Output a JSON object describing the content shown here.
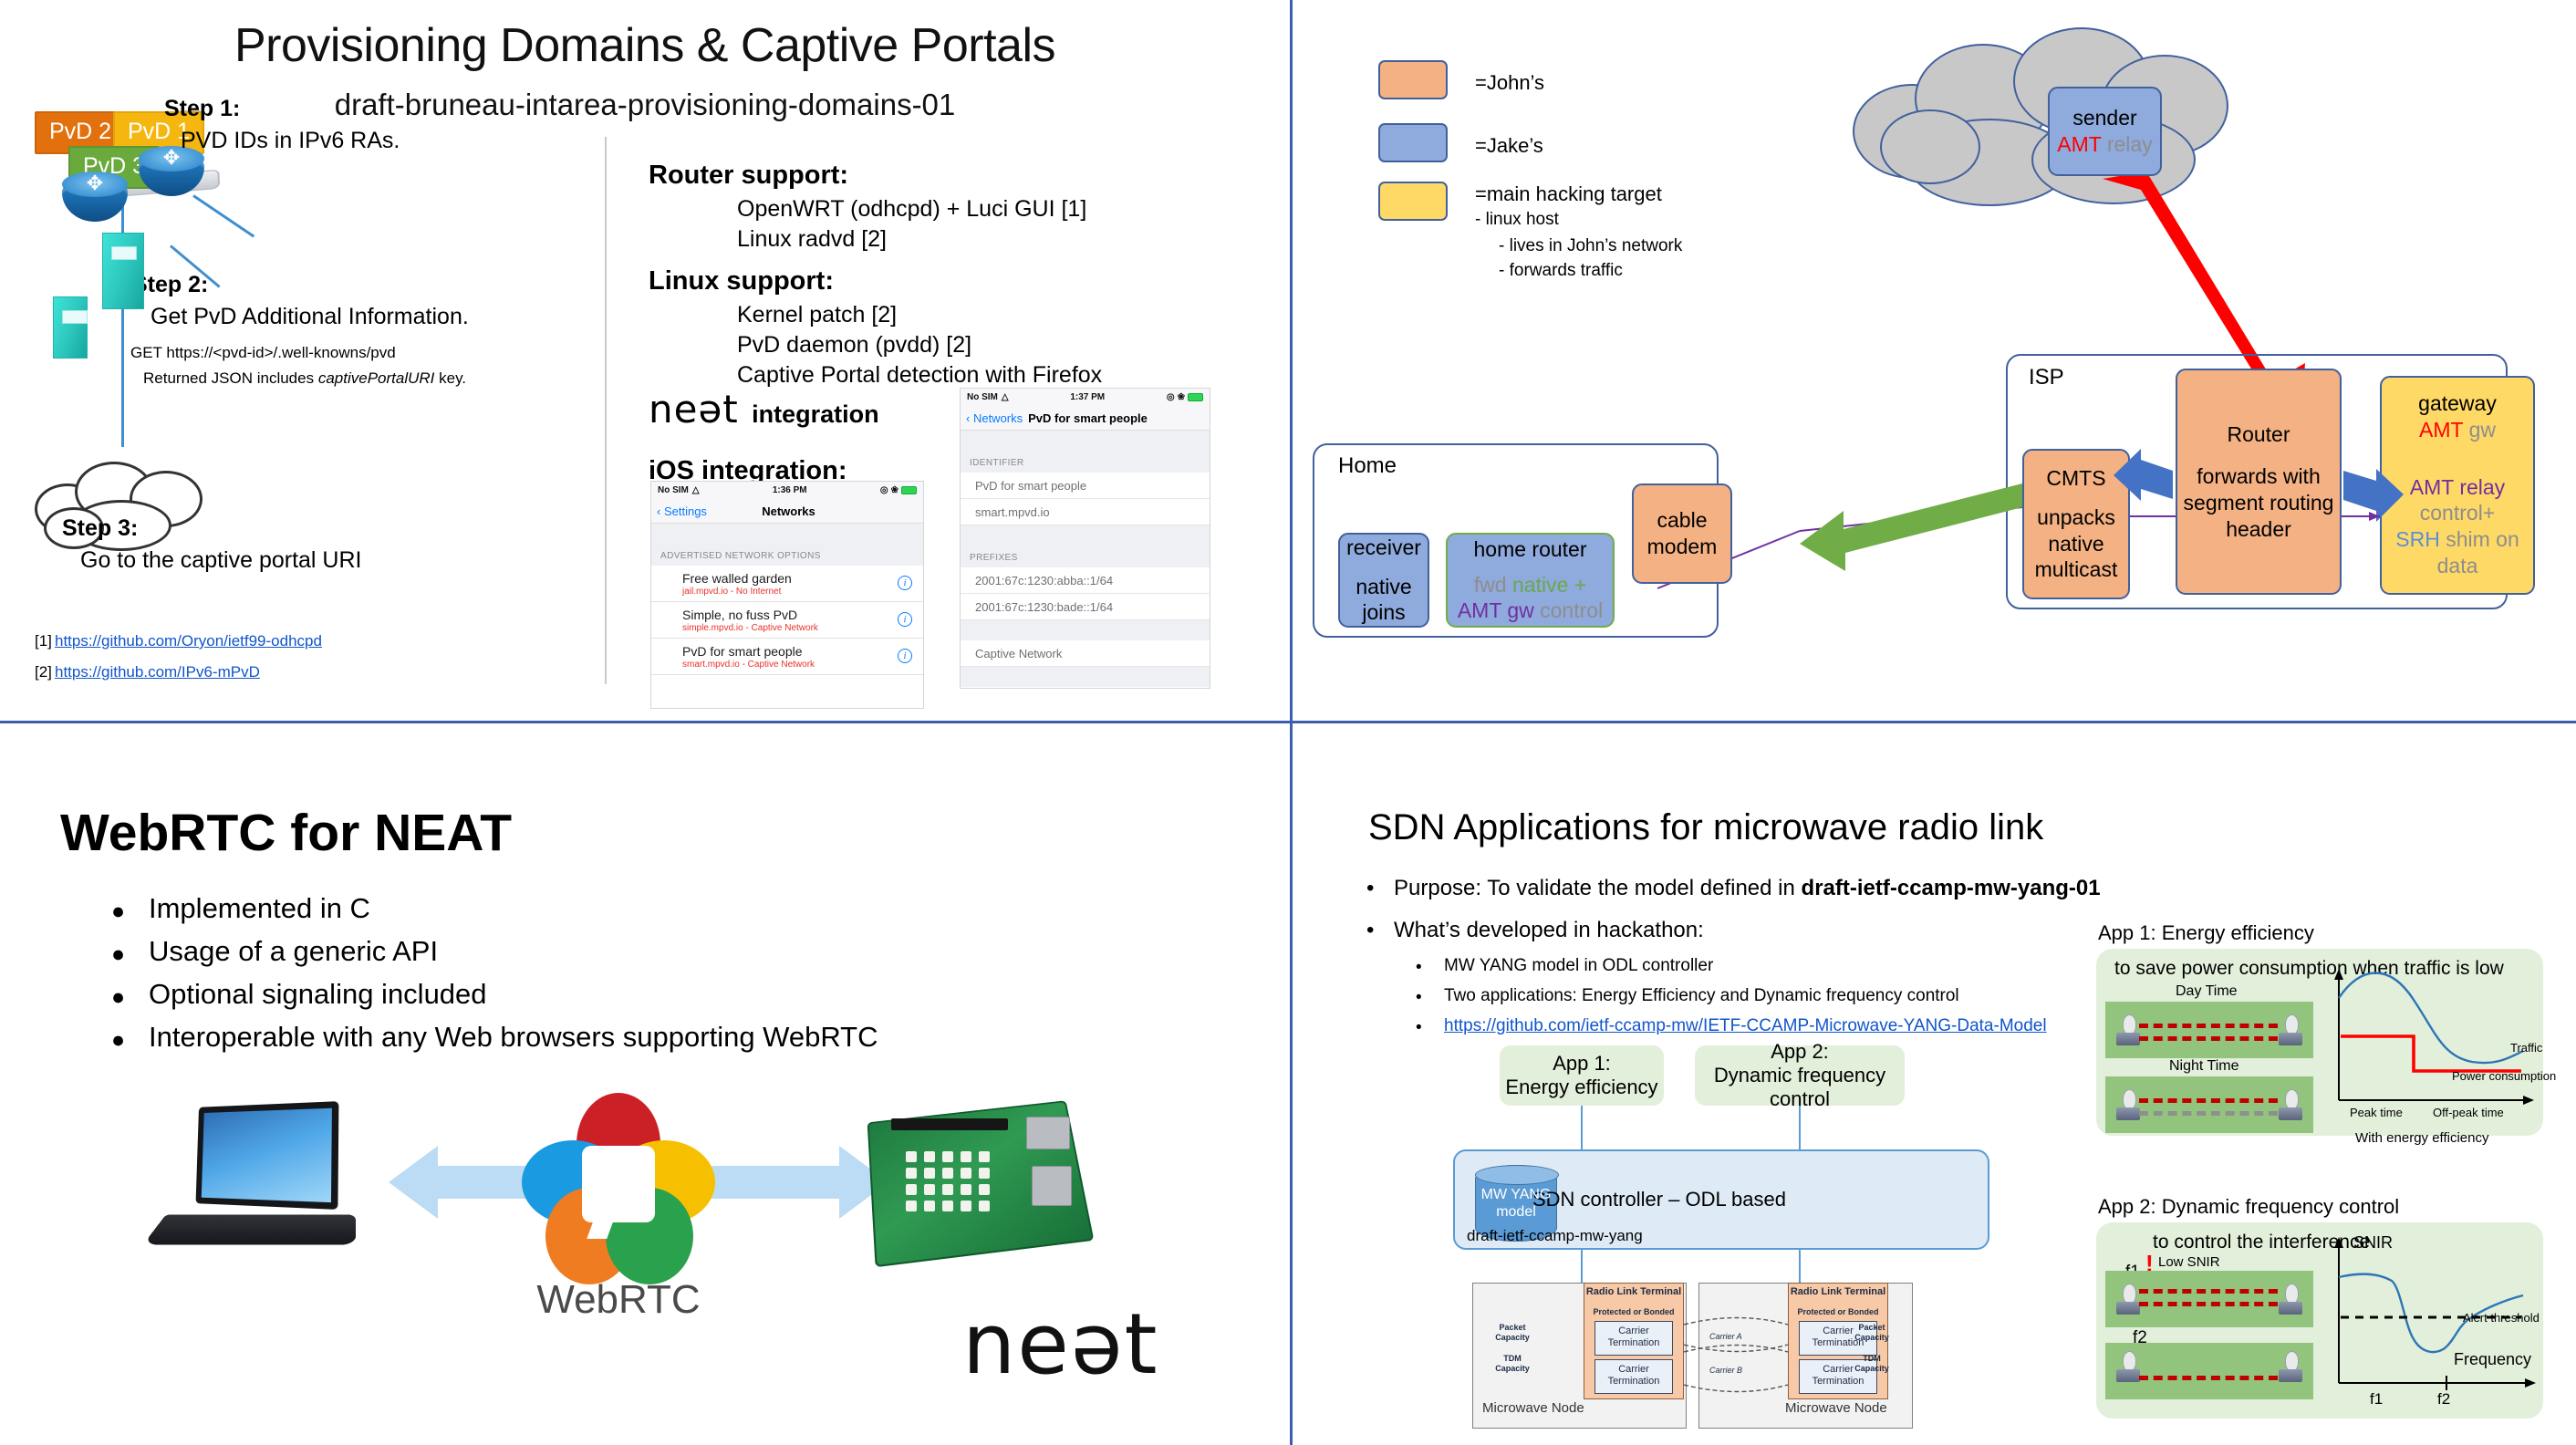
{
  "slide_pvd": {
    "title": "Provisioning Domains & Captive Portals",
    "subtitle": "draft-bruneau-intarea-provisioning-domains-01",
    "tags": {
      "pvd1": "PvD 1",
      "pvd2": "PvD 2",
      "pvd3": "PvD 3"
    },
    "steps": [
      {
        "label": "Step 1:",
        "text": "PVD IDs in IPv6 RAs."
      },
      {
        "label": "Step 2:",
        "text": "Get PvD Additional Information."
      },
      {
        "label": "Step 3:",
        "text": "Go to the captive portal URI"
      }
    ],
    "step2_detail_1": "GET https://<pvd-id>/.well-knowns/pvd",
    "step2_detail_2a": "Returned JSON includes ",
    "step2_detail_2b": "captivePortalURI",
    "step2_detail_2c": " key.",
    "router_support": {
      "heading": "Router support:",
      "items": [
        "OpenWRT (odhcpd)  + Luci GUI [1]",
        "Linux radvd [2]"
      ]
    },
    "linux_support": {
      "heading": "Linux support:",
      "items": [
        "Kernel patch [2]",
        "PvD daemon (pvdd)  [2]",
        "Captive Portal detection with Firefox"
      ]
    },
    "neat_integration": {
      "logo": "neət",
      "label": "integration"
    },
    "ios_integration_heading": "iOS integration:",
    "references": [
      {
        "num": "[1]",
        "url": "https://github.com/Oryon/ietf99-odhcpd"
      },
      {
        "num": "[2]",
        "url": "https://github.com/IPv6-mPvD"
      }
    ],
    "phone_networks": {
      "carrier": "No SIM",
      "time": "1:36 PM",
      "back": "Settings",
      "title": "Networks",
      "section": "ADVERTISED NETWORK OPTIONS",
      "rows": [
        {
          "title": "Free walled garden",
          "sub": "jail.mpvd.io - No Internet"
        },
        {
          "title": "Simple, no fuss PvD",
          "sub": "simple.mpvd.io - Captive Network"
        },
        {
          "title": "PvD for smart people",
          "sub": "smart.mpvd.io - Captive Network"
        }
      ]
    },
    "phone_detail": {
      "carrier": "No SIM",
      "time": "1:37 PM",
      "back": "Networks",
      "title": "PvD for smart people",
      "section_identifier": "IDENTIFIER",
      "identifier_rows": [
        "PvD for smart people",
        "smart.mpvd.io"
      ],
      "section_prefixes": "PREFIXES",
      "prefix_rows": [
        "2001:67c:1230:abba::1/64",
        "2001:67c:1230:bade::1/64"
      ],
      "captive_row": "Captive Network"
    }
  },
  "slide_amt": {
    "legend": [
      {
        "color": "#f4b183",
        "label": "=John’s"
      },
      {
        "color": "#8faadc",
        "label": "=Jake’s"
      },
      {
        "color": "#ffd966",
        "label": "=main hacking target"
      }
    ],
    "legend_sub": [
      "- linux host",
      "-   lives in John’s network",
      "-   forwards traffic"
    ],
    "sender": {
      "line1": "sender",
      "line2a": "AMT",
      "line2b": "relay"
    },
    "home": {
      "group_label": "Home",
      "receiver": {
        "line1": "receiver",
        "line2": "native",
        "line3": "joins"
      },
      "home_router": {
        "line1": "home router",
        "line2a": "fwd ",
        "line2b": "native +",
        "line3a": "AMT gw",
        "line3b": " control"
      },
      "cable_modem": {
        "line1": "cable",
        "line2": "modem"
      }
    },
    "isp": {
      "group_label": "ISP",
      "cmts": {
        "line1": "CMTS",
        "line2": "unpacks",
        "line3": "native",
        "line4": "multicast"
      },
      "router": {
        "line1": "Router",
        "line2": "forwards with",
        "line3": "segment routing",
        "line4": "header"
      },
      "gateway": {
        "line1": "gateway",
        "line2a": "AMT",
        "line2b": "gw",
        "line3a": "AMT relay",
        "line3b": "control+",
        "line4a": "SRH",
        "line4b": " shim on",
        "line5": "data"
      }
    }
  },
  "slide_webrtc": {
    "title": "WebRTC for NEAT",
    "bullets": [
      "Implemented in C",
      "Usage of a generic API",
      "Optional signaling included",
      "Interoperable with any Web browsers supporting WebRTC"
    ],
    "logo_word": "WebRTC",
    "neat_word": "neət"
  },
  "slide_sdn": {
    "title": "SDN Applications for microwave radio link",
    "bullet1_prefix": "Purpose: To validate the model defined in ",
    "bullet1_bold": "draft-ietf-ccamp-mw-yang-01",
    "bullet2": "What’s developed in hackathon:",
    "sub_bullets": [
      "MW YANG model in ODL controller",
      "Two applications: Energy Efficiency and Dynamic frequency control"
    ],
    "sub_link": "https://github.com/ietf-ccamp-mw/IETF-CCAMP-Microwave-YANG-Data-Model",
    "app1_box": {
      "line1": "App 1:",
      "line2": "Energy efficiency"
    },
    "app2_box": {
      "line1": "App 2:",
      "line2": "Dynamic frequency control"
    },
    "controller": {
      "title": "SDN controller – ODL based",
      "cyl1": "MW YANG",
      "cyl2": "model",
      "draft": "draft-ietf-ccamp-mw-yang"
    },
    "microwave": {
      "node_label": "Microwave Node",
      "rlt_label": "Radio Link Terminal",
      "protected": "Protected or Bonded",
      "carrier_termination": "Carrier\nTermination",
      "packet_capacity": "Packet\nCapacity",
      "tdm_capacity": "TDM\nCapacity",
      "carrier_a": "Carrier  A",
      "carrier_b": "Carrier  B"
    },
    "app1_panel": {
      "heading": "App 1:  Energy efficiency",
      "sub": "to save power consumption when traffic is low",
      "day": "Day Time",
      "night": "Night Time",
      "traffic": "Traffic",
      "power": "Power consumption",
      "peak": "Peak time",
      "offpeak": "Off-peak time",
      "footer": "With energy efficiency"
    },
    "app2_panel": {
      "heading": "App 2: Dynamic frequency control",
      "sub": "to control the interference",
      "low_snir": "Low SNIR",
      "f1": "f1",
      "f2": "f2",
      "snir": "SNIR",
      "alert": "Alert threshold",
      "frequency": "Frequency",
      "xtick1": "f1",
      "xtick2": "f2"
    }
  },
  "chart_data": [
    {
      "type": "line",
      "title": "Energy efficiency",
      "xlabel": "",
      "ylabel": "",
      "xticks": [
        "Peak time",
        "Off-peak time"
      ],
      "series": [
        {
          "name": "Traffic",
          "color": "#2e75b6",
          "values": [
            55,
            88,
            95,
            70,
            38,
            24,
            22,
            30
          ]
        },
        {
          "name": "Power consumption",
          "color": "#ff0000",
          "values": [
            62,
            62,
            62,
            62,
            20,
            20,
            20,
            20
          ]
        }
      ],
      "annotation": "With energy efficiency"
    },
    {
      "type": "line",
      "title": "Dynamic frequency control",
      "xlabel": "Frequency",
      "ylabel": "SNIR",
      "xticks": [
        "f1",
        "f2"
      ],
      "series": [
        {
          "name": "SNIR",
          "color": "#2e75b6",
          "values": [
            72,
            74,
            73,
            40,
            14,
            12,
            16,
            56,
            68,
            78
          ]
        }
      ],
      "threshold": {
        "label": "Alert threshold",
        "value": 46
      }
    }
  ]
}
